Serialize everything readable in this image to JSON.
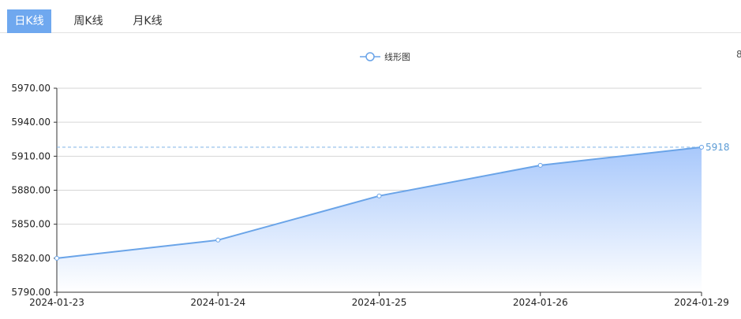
{
  "tabs": [
    {
      "label": "日K线",
      "active": true
    },
    {
      "label": "周K线",
      "active": false
    },
    {
      "label": "月K线",
      "active": false
    }
  ],
  "edge_mark": "8",
  "colors": {
    "accent": "#6fa8ef",
    "line": "#6aa4e8",
    "area_top": "#a8c8fb",
    "area_bottom": "#ffffff",
    "markline": "#7fb3e8"
  },
  "chart_data": {
    "type": "area",
    "x": [
      "2024-01-23",
      "2024-01-24",
      "2024-01-25",
      "2024-01-26",
      "2024-01-29"
    ],
    "series": [
      {
        "name": "线形图",
        "values": [
          5820,
          5836,
          5875,
          5902,
          5918
        ]
      }
    ],
    "ylim": [
      5790,
      5970
    ],
    "yticks": [
      "5790.00",
      "5820.00",
      "5850.00",
      "5880.00",
      "5910.00",
      "5940.00",
      "5970.00"
    ],
    "ytick_values": [
      5790,
      5820,
      5850,
      5880,
      5910,
      5940,
      5970
    ],
    "markline": {
      "value": 5918,
      "label": "5918"
    },
    "grid": true,
    "legend": "top-center"
  }
}
